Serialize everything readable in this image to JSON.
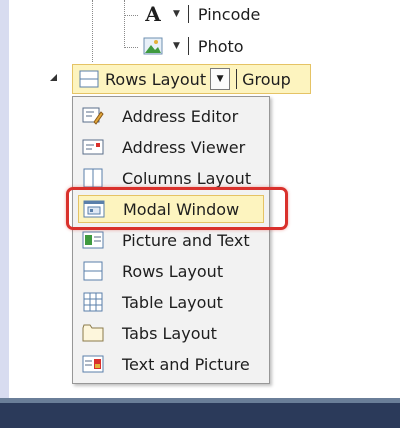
{
  "tree": {
    "fields": [
      {
        "icon": "font-a-icon",
        "glyph": "A",
        "label": "Pincode"
      },
      {
        "icon": "image-icon",
        "label": "Photo"
      }
    ]
  },
  "layout_group": {
    "layout_label": "Rows Layout",
    "group_label": "Group"
  },
  "menu": {
    "items": [
      {
        "label": "Address Editor",
        "icon": "address-editor-icon"
      },
      {
        "label": "Address Viewer",
        "icon": "address-viewer-icon"
      },
      {
        "label": "Columns Layout",
        "icon": "columns-layout-icon"
      },
      {
        "label": "Modal Window",
        "icon": "modal-window-icon",
        "selected": true
      },
      {
        "label": "Picture and Text",
        "icon": "picture-and-text-icon"
      },
      {
        "label": "Rows Layout",
        "icon": "rows-layout-icon"
      },
      {
        "label": "Table Layout",
        "icon": "table-layout-icon"
      },
      {
        "label": "Tabs Layout",
        "icon": "tabs-layout-icon"
      },
      {
        "label": "Text and Picture",
        "icon": "text-and-picture-icon"
      }
    ]
  },
  "colors": {
    "selection_fill": "#fdf4bf",
    "selection_border": "#e5c365",
    "callout_red": "#d9312c"
  }
}
